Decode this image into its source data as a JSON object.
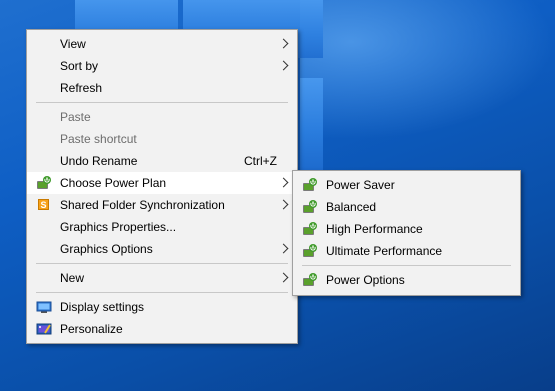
{
  "context_menu": {
    "items": [
      {
        "label": "View"
      },
      {
        "label": "Sort by"
      },
      {
        "label": "Refresh"
      },
      {
        "label": "Paste"
      },
      {
        "label": "Paste shortcut"
      },
      {
        "label": "Undo Rename",
        "accel": "Ctrl+Z"
      },
      {
        "label": "Choose Power Plan"
      },
      {
        "label": "Shared Folder Synchronization"
      },
      {
        "label": "Graphics Properties..."
      },
      {
        "label": "Graphics Options"
      },
      {
        "label": "New"
      },
      {
        "label": "Display settings"
      },
      {
        "label": "Personalize"
      }
    ]
  },
  "power_submenu": {
    "items": [
      {
        "label": "Power Saver"
      },
      {
        "label": "Balanced"
      },
      {
        "label": "High Performance"
      },
      {
        "label": "Ultimate Performance"
      },
      {
        "label": "Power Options"
      }
    ]
  },
  "colors": {
    "desktop_blue": "#0e5ec4",
    "menu_background": "#f2f2f2",
    "highlight": "#ffffff",
    "disabled_text": "#6d6d6d"
  }
}
